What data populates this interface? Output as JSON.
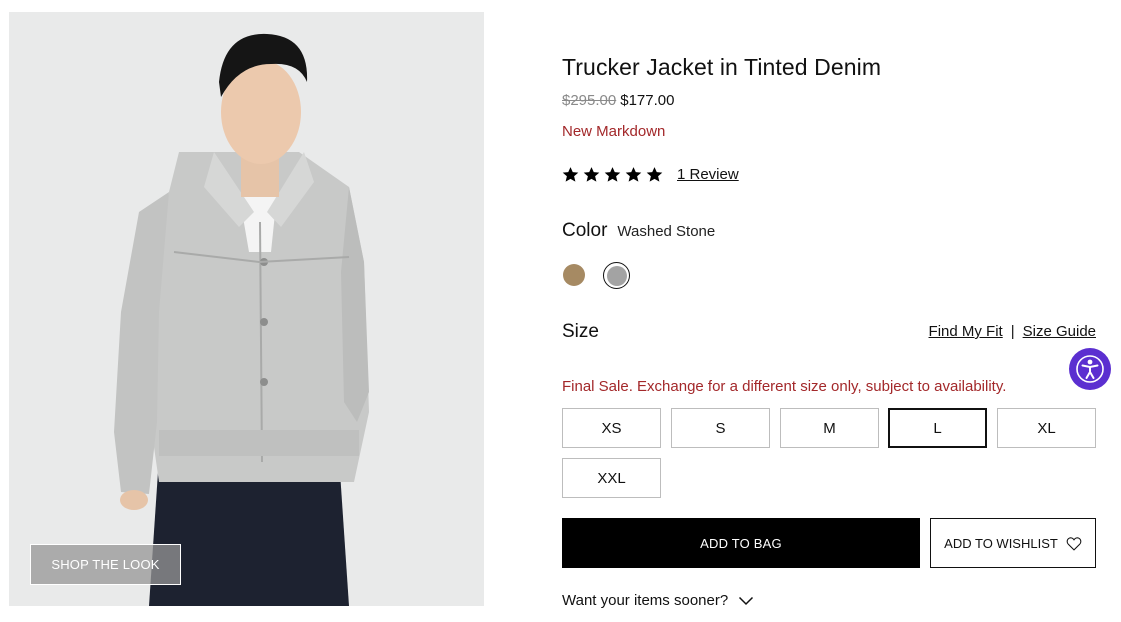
{
  "product": {
    "title": "Trucker Jacket in Tinted Denim",
    "price_original": "$295.00",
    "price_sale": "$177.00",
    "markdown_label": "New Markdown",
    "rating_stars": 5,
    "review_link": "1 Review"
  },
  "image": {
    "shop_the_look": "SHOP THE LOOK"
  },
  "color": {
    "label": "Color",
    "selected_value": "Washed Stone",
    "swatches": [
      {
        "name": "tan",
        "hex": "#a68a63"
      },
      {
        "name": "washed-stone",
        "hex": "#a3a3a3",
        "selected": true
      }
    ]
  },
  "size": {
    "label": "Size",
    "find_my_fit": "Find My Fit",
    "separator": "|",
    "size_guide": "Size Guide",
    "final_sale_notice": "Final Sale. Exchange for a different size only, subject to availability.",
    "options": [
      "XS",
      "S",
      "M",
      "L",
      "XL",
      "XXL"
    ],
    "selected": "L"
  },
  "actions": {
    "add_to_bag": "ADD TO BAG",
    "add_to_wishlist": "ADD TO WISHLIST"
  },
  "shipping": {
    "want_sooner": "Want your items sooner?"
  },
  "colors": {
    "sale_red": "#a3282a",
    "accessibility_purple": "#5b2fd0"
  }
}
